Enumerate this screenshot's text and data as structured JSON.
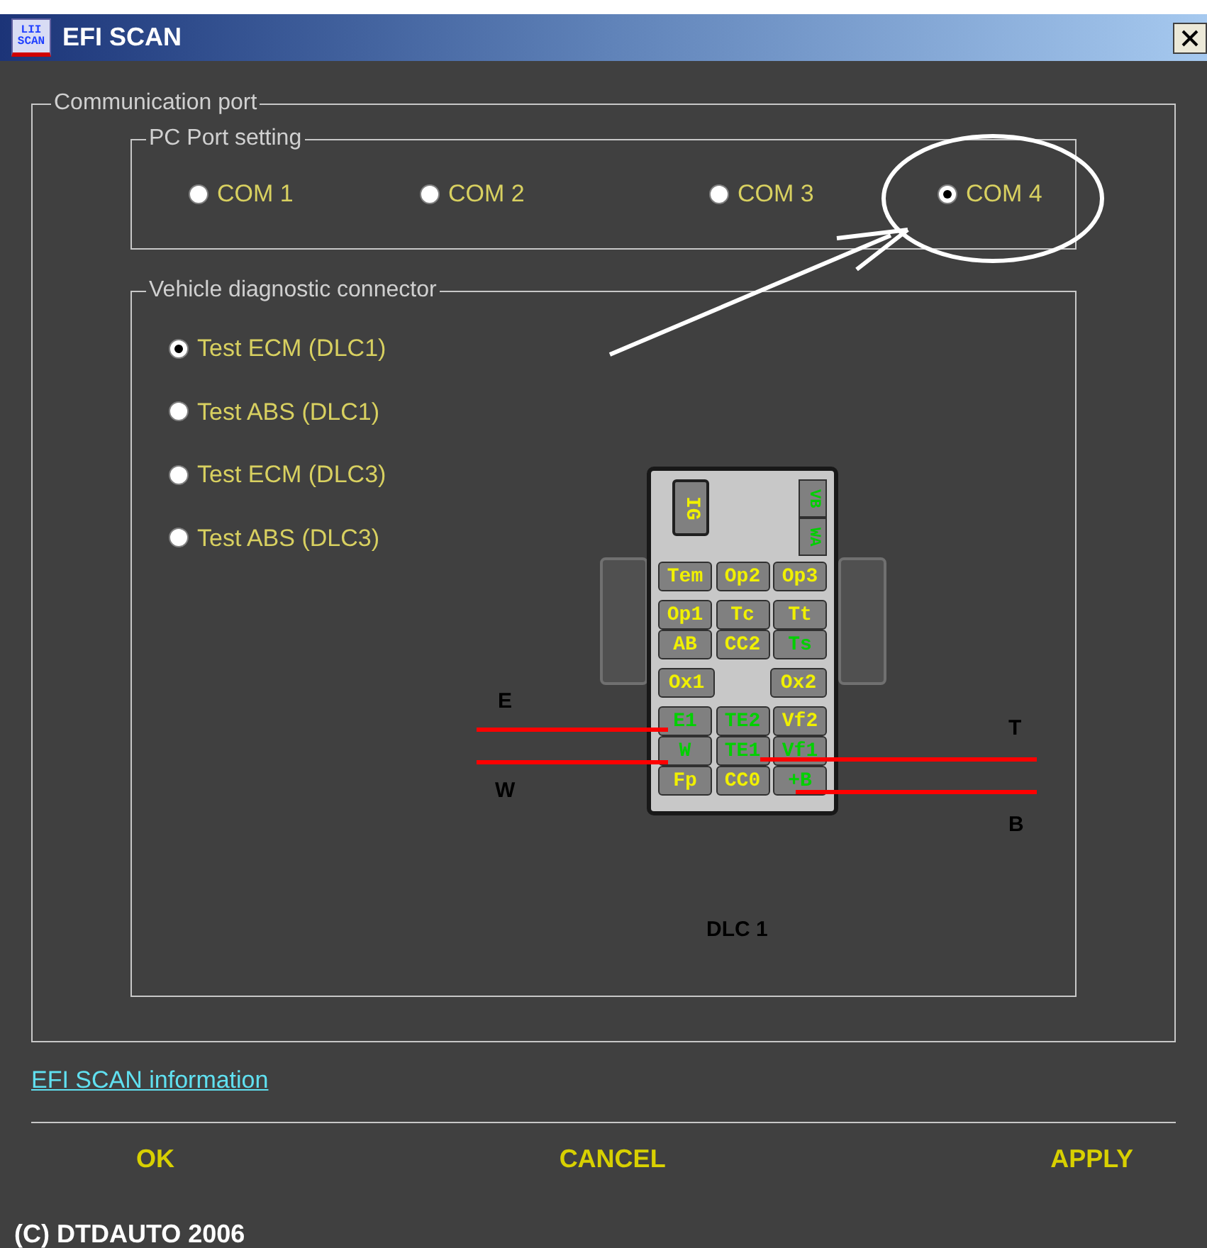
{
  "window": {
    "title": "EFI SCAN",
    "logo_text": [
      "LII",
      "SCAN"
    ]
  },
  "communication_port": {
    "title": "Communication port",
    "pc_port": {
      "title": "PC Port setting",
      "ports": [
        {
          "label": "COM 1",
          "selected": false
        },
        {
          "label": "COM 2",
          "selected": false
        },
        {
          "label": "COM 3",
          "selected": false
        },
        {
          "label": "COM 4",
          "selected": true
        }
      ]
    },
    "vehicle_connector": {
      "title": "Vehicle diagnostic connector",
      "options": [
        {
          "label": "Test ECM (DLC1)",
          "selected": true
        },
        {
          "label": "Test ABS (DLC1)",
          "selected": false
        },
        {
          "label": "Test ECM (DLC3)",
          "selected": false
        },
        {
          "label": "Test ABS (DLC3)",
          "selected": false
        }
      ],
      "connector": {
        "name": "DLC 1",
        "plug": {
          "label": "IG",
          "active": false
        },
        "side_pins": [
          {
            "label": "VB",
            "active": true
          },
          {
            "label": "WA",
            "active": true
          }
        ],
        "pin_rows": [
          [
            {
              "label": "Tem",
              "active": false
            },
            {
              "label": "Op2",
              "active": false
            },
            {
              "label": "Op3",
              "active": false
            }
          ],
          [
            {
              "label": "Op1",
              "active": false
            },
            {
              "label": "Tc",
              "active": false
            },
            {
              "label": "Tt",
              "active": false
            }
          ],
          [
            {
              "label": "AB",
              "active": false
            },
            {
              "label": "CC2",
              "active": false
            },
            {
              "label": "Ts",
              "active": true
            }
          ],
          [
            {
              "label": "Ox1",
              "active": false
            },
            {
              "label": "Ox2",
              "active": false
            }
          ],
          [
            {
              "label": "E1",
              "active": true
            },
            {
              "label": "TE2",
              "active": true
            },
            {
              "label": "Vf2",
              "active": false
            }
          ],
          [
            {
              "label": "W",
              "active": true
            },
            {
              "label": "TE1",
              "active": true
            },
            {
              "label": "Vf1",
              "active": true
            }
          ],
          [
            {
              "label": "Fp",
              "active": false
            },
            {
              "label": "CC0",
              "active": false
            },
            {
              "label": "+B",
              "active": true
            }
          ]
        ],
        "wires": [
          {
            "label": "E"
          },
          {
            "label": "W"
          },
          {
            "label": "T"
          },
          {
            "label": "B"
          }
        ]
      }
    }
  },
  "info_link": "EFI SCAN information",
  "buttons": [
    "OK",
    "CANCEL",
    "APPLY"
  ],
  "footer": "(C) DTDAUTO 2006"
}
